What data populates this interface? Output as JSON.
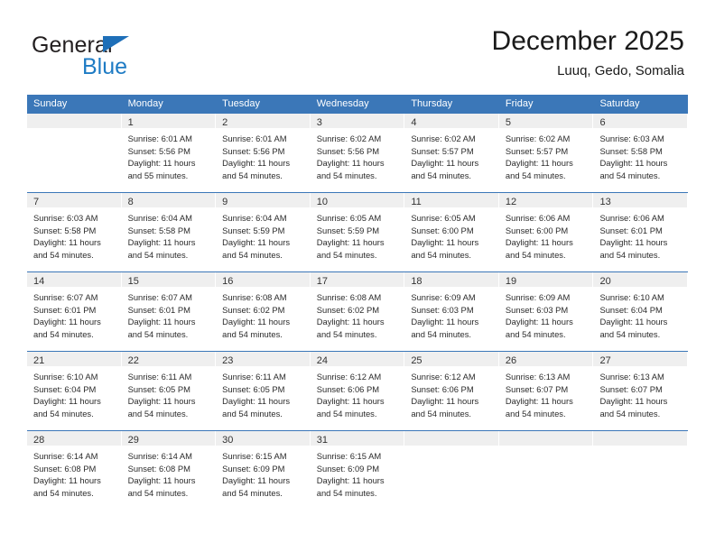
{
  "brand": {
    "name_top": "General",
    "name_bottom": "Blue",
    "flag_icon": "blue-triangle-flag",
    "accent_color": "#1e7bc4"
  },
  "header": {
    "title": "December 2025",
    "subtitle": "Luuq, Gedo, Somalia"
  },
  "theme": {
    "header_bar_color": "#3b77b8",
    "day_band_color": "#efefef",
    "row_divider_color": "#3b77b8",
    "text_color": "#2b2b2b"
  },
  "weekdays": [
    "Sunday",
    "Monday",
    "Tuesday",
    "Wednesday",
    "Thursday",
    "Friday",
    "Saturday"
  ],
  "weeks": [
    [
      {
        "day": "",
        "empty": true,
        "sunrise": "",
        "sunset": "",
        "daylight_1": "",
        "daylight_2": ""
      },
      {
        "day": "1",
        "sunrise": "Sunrise: 6:01 AM",
        "sunset": "Sunset: 5:56 PM",
        "daylight_1": "Daylight: 11 hours",
        "daylight_2": "and 55 minutes."
      },
      {
        "day": "2",
        "sunrise": "Sunrise: 6:01 AM",
        "sunset": "Sunset: 5:56 PM",
        "daylight_1": "Daylight: 11 hours",
        "daylight_2": "and 54 minutes."
      },
      {
        "day": "3",
        "sunrise": "Sunrise: 6:02 AM",
        "sunset": "Sunset: 5:56 PM",
        "daylight_1": "Daylight: 11 hours",
        "daylight_2": "and 54 minutes."
      },
      {
        "day": "4",
        "sunrise": "Sunrise: 6:02 AM",
        "sunset": "Sunset: 5:57 PM",
        "daylight_1": "Daylight: 11 hours",
        "daylight_2": "and 54 minutes."
      },
      {
        "day": "5",
        "sunrise": "Sunrise: 6:02 AM",
        "sunset": "Sunset: 5:57 PM",
        "daylight_1": "Daylight: 11 hours",
        "daylight_2": "and 54 minutes."
      },
      {
        "day": "6",
        "sunrise": "Sunrise: 6:03 AM",
        "sunset": "Sunset: 5:58 PM",
        "daylight_1": "Daylight: 11 hours",
        "daylight_2": "and 54 minutes."
      }
    ],
    [
      {
        "day": "7",
        "sunrise": "Sunrise: 6:03 AM",
        "sunset": "Sunset: 5:58 PM",
        "daylight_1": "Daylight: 11 hours",
        "daylight_2": "and 54 minutes."
      },
      {
        "day": "8",
        "sunrise": "Sunrise: 6:04 AM",
        "sunset": "Sunset: 5:58 PM",
        "daylight_1": "Daylight: 11 hours",
        "daylight_2": "and 54 minutes."
      },
      {
        "day": "9",
        "sunrise": "Sunrise: 6:04 AM",
        "sunset": "Sunset: 5:59 PM",
        "daylight_1": "Daylight: 11 hours",
        "daylight_2": "and 54 minutes."
      },
      {
        "day": "10",
        "sunrise": "Sunrise: 6:05 AM",
        "sunset": "Sunset: 5:59 PM",
        "daylight_1": "Daylight: 11 hours",
        "daylight_2": "and 54 minutes."
      },
      {
        "day": "11",
        "sunrise": "Sunrise: 6:05 AM",
        "sunset": "Sunset: 6:00 PM",
        "daylight_1": "Daylight: 11 hours",
        "daylight_2": "and 54 minutes."
      },
      {
        "day": "12",
        "sunrise": "Sunrise: 6:06 AM",
        "sunset": "Sunset: 6:00 PM",
        "daylight_1": "Daylight: 11 hours",
        "daylight_2": "and 54 minutes."
      },
      {
        "day": "13",
        "sunrise": "Sunrise: 6:06 AM",
        "sunset": "Sunset: 6:01 PM",
        "daylight_1": "Daylight: 11 hours",
        "daylight_2": "and 54 minutes."
      }
    ],
    [
      {
        "day": "14",
        "sunrise": "Sunrise: 6:07 AM",
        "sunset": "Sunset: 6:01 PM",
        "daylight_1": "Daylight: 11 hours",
        "daylight_2": "and 54 minutes."
      },
      {
        "day": "15",
        "sunrise": "Sunrise: 6:07 AM",
        "sunset": "Sunset: 6:01 PM",
        "daylight_1": "Daylight: 11 hours",
        "daylight_2": "and 54 minutes."
      },
      {
        "day": "16",
        "sunrise": "Sunrise: 6:08 AM",
        "sunset": "Sunset: 6:02 PM",
        "daylight_1": "Daylight: 11 hours",
        "daylight_2": "and 54 minutes."
      },
      {
        "day": "17",
        "sunrise": "Sunrise: 6:08 AM",
        "sunset": "Sunset: 6:02 PM",
        "daylight_1": "Daylight: 11 hours",
        "daylight_2": "and 54 minutes."
      },
      {
        "day": "18",
        "sunrise": "Sunrise: 6:09 AM",
        "sunset": "Sunset: 6:03 PM",
        "daylight_1": "Daylight: 11 hours",
        "daylight_2": "and 54 minutes."
      },
      {
        "day": "19",
        "sunrise": "Sunrise: 6:09 AM",
        "sunset": "Sunset: 6:03 PM",
        "daylight_1": "Daylight: 11 hours",
        "daylight_2": "and 54 minutes."
      },
      {
        "day": "20",
        "sunrise": "Sunrise: 6:10 AM",
        "sunset": "Sunset: 6:04 PM",
        "daylight_1": "Daylight: 11 hours",
        "daylight_2": "and 54 minutes."
      }
    ],
    [
      {
        "day": "21",
        "sunrise": "Sunrise: 6:10 AM",
        "sunset": "Sunset: 6:04 PM",
        "daylight_1": "Daylight: 11 hours",
        "daylight_2": "and 54 minutes."
      },
      {
        "day": "22",
        "sunrise": "Sunrise: 6:11 AM",
        "sunset": "Sunset: 6:05 PM",
        "daylight_1": "Daylight: 11 hours",
        "daylight_2": "and 54 minutes."
      },
      {
        "day": "23",
        "sunrise": "Sunrise: 6:11 AM",
        "sunset": "Sunset: 6:05 PM",
        "daylight_1": "Daylight: 11 hours",
        "daylight_2": "and 54 minutes."
      },
      {
        "day": "24",
        "sunrise": "Sunrise: 6:12 AM",
        "sunset": "Sunset: 6:06 PM",
        "daylight_1": "Daylight: 11 hours",
        "daylight_2": "and 54 minutes."
      },
      {
        "day": "25",
        "sunrise": "Sunrise: 6:12 AM",
        "sunset": "Sunset: 6:06 PM",
        "daylight_1": "Daylight: 11 hours",
        "daylight_2": "and 54 minutes."
      },
      {
        "day": "26",
        "sunrise": "Sunrise: 6:13 AM",
        "sunset": "Sunset: 6:07 PM",
        "daylight_1": "Daylight: 11 hours",
        "daylight_2": "and 54 minutes."
      },
      {
        "day": "27",
        "sunrise": "Sunrise: 6:13 AM",
        "sunset": "Sunset: 6:07 PM",
        "daylight_1": "Daylight: 11 hours",
        "daylight_2": "and 54 minutes."
      }
    ],
    [
      {
        "day": "28",
        "sunrise": "Sunrise: 6:14 AM",
        "sunset": "Sunset: 6:08 PM",
        "daylight_1": "Daylight: 11 hours",
        "daylight_2": "and 54 minutes."
      },
      {
        "day": "29",
        "sunrise": "Sunrise: 6:14 AM",
        "sunset": "Sunset: 6:08 PM",
        "daylight_1": "Daylight: 11 hours",
        "daylight_2": "and 54 minutes."
      },
      {
        "day": "30",
        "sunrise": "Sunrise: 6:15 AM",
        "sunset": "Sunset: 6:09 PM",
        "daylight_1": "Daylight: 11 hours",
        "daylight_2": "and 54 minutes."
      },
      {
        "day": "31",
        "sunrise": "Sunrise: 6:15 AM",
        "sunset": "Sunset: 6:09 PM",
        "daylight_1": "Daylight: 11 hours",
        "daylight_2": "and 54 minutes."
      },
      {
        "day": "",
        "empty": true,
        "sunrise": "",
        "sunset": "",
        "daylight_1": "",
        "daylight_2": ""
      },
      {
        "day": "",
        "empty": true,
        "sunrise": "",
        "sunset": "",
        "daylight_1": "",
        "daylight_2": ""
      },
      {
        "day": "",
        "empty": true,
        "sunrise": "",
        "sunset": "",
        "daylight_1": "",
        "daylight_2": ""
      }
    ]
  ]
}
